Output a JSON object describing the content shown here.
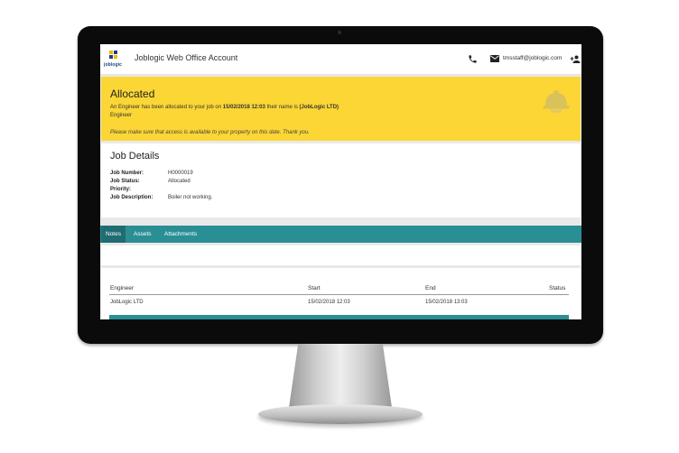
{
  "app": {
    "logo_text": "joblogic",
    "title": "Joblogic Web Office Account",
    "user_email": "tmsstaff@joblogic.com"
  },
  "icons": {
    "phone": "phone-icon",
    "mail": "mail-icon",
    "user": "person-add-icon",
    "helmet": "hard-hat-icon"
  },
  "colors": {
    "alert": "#fbd635",
    "tabs": "#2a8f95",
    "tab_active": "#1f6d72"
  },
  "alert": {
    "title": "Allocated",
    "line_prefix": "An Engineer has been allocated to your job on ",
    "datetime": "15/02/2018 12:03",
    "line_mid": " their name is ",
    "engineer": "(JobLogic LTD)",
    "role": "Engineer",
    "note": "Please make sure that access is available to your property on this date. Thank you."
  },
  "job_details": {
    "title": "Job Details",
    "rows": [
      {
        "label": "Job Number:",
        "value": "H0000019"
      },
      {
        "label": "Job Status:",
        "value": "Allocated"
      },
      {
        "label": "Priority:",
        "value": ""
      },
      {
        "label": "Job Description:",
        "value": "Boiler not working."
      }
    ]
  },
  "tabs": [
    {
      "label": "Notes",
      "active": true
    },
    {
      "label": "Assets",
      "active": false
    },
    {
      "label": "Attachments",
      "active": false
    }
  ],
  "table": {
    "columns": [
      "Engineer",
      "Start",
      "End",
      "Status"
    ],
    "rows": [
      [
        "JobLogic LTD",
        "15/02/2018 12:03",
        "15/02/2018 13:03",
        ""
      ]
    ]
  }
}
